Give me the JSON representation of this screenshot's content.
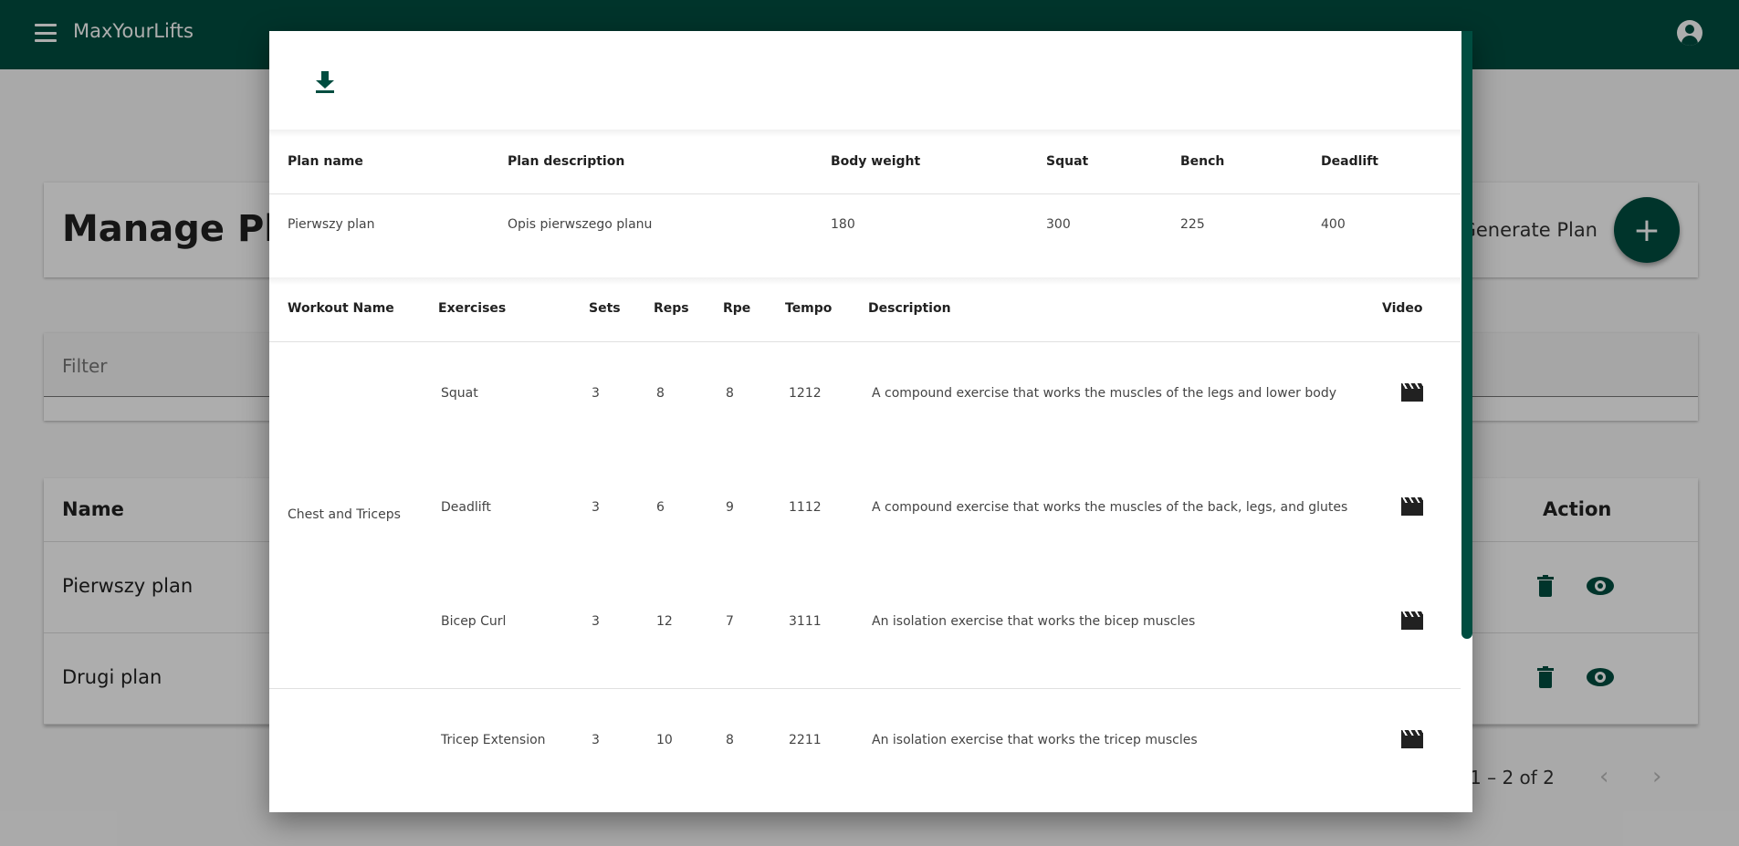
{
  "app": {
    "title": "MaxYourLifts"
  },
  "page": {
    "title": "Manage Pla",
    "generate_label": "Generate Plan",
    "fab_label": "+",
    "filter_placeholder": "Filter",
    "list": {
      "col_name": "Name",
      "col_action": "Action",
      "rows": [
        {
          "name": "Pierwszy plan"
        },
        {
          "name": "Drugi plan"
        }
      ]
    },
    "paginator": {
      "range": "1 – 2 of 2",
      "prev": "‹",
      "next": "›"
    }
  },
  "dialog": {
    "plan_table": {
      "headers": [
        "Plan name",
        "Plan description",
        "Body weight",
        "Squat",
        "Bench",
        "Deadlift"
      ],
      "row": [
        "Pierwszy plan",
        "Opis pierwszego planu",
        "180",
        "300",
        "225",
        "400"
      ]
    },
    "workout_table": {
      "headers": [
        "Workout Name",
        "Exercises",
        "Sets",
        "Reps",
        "Rpe",
        "Tempo",
        "Description",
        "Video"
      ],
      "workout_name": "Chest and Triceps",
      "exercises": [
        {
          "name": "Squat",
          "sets": "3",
          "reps": "8",
          "rpe": "8",
          "tempo": "1212",
          "description": "A compound exercise that works the muscles of the legs and lower body"
        },
        {
          "name": "Deadlift",
          "sets": "3",
          "reps": "6",
          "rpe": "9",
          "tempo": "1112",
          "description": "A compound exercise that works the muscles of the back, legs, and glutes"
        },
        {
          "name": "Bicep Curl",
          "sets": "3",
          "reps": "12",
          "rpe": "7",
          "tempo": "3111",
          "description": "An isolation exercise that works the bicep muscles"
        },
        {
          "name": "Tricep Extension",
          "sets": "3",
          "reps": "10",
          "rpe": "8",
          "tempo": "2211",
          "description": "An isolation exercise that works the tricep muscles"
        }
      ]
    }
  }
}
